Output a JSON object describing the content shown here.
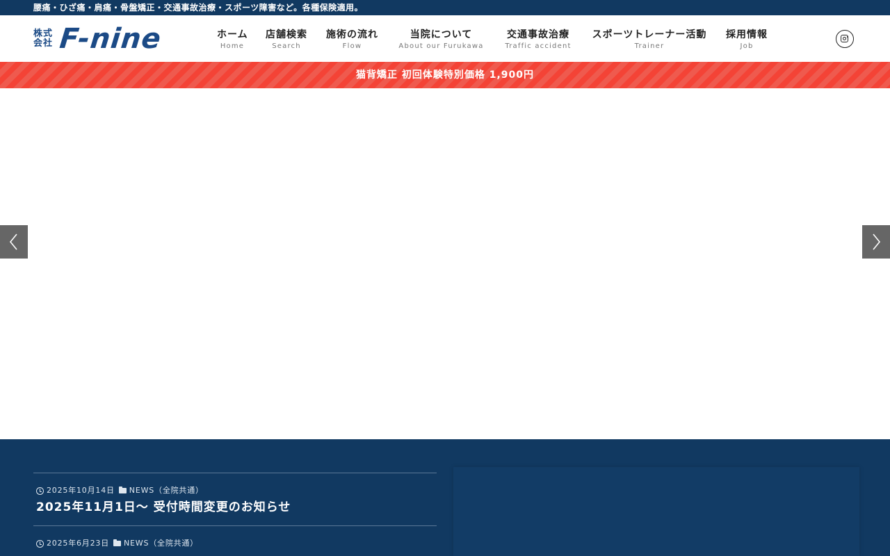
{
  "topbar": {
    "text": "腰痛・ひざ痛・肩痛・骨盤矯正・交通事故治療・スポーツ障害など。各種保険適用。"
  },
  "logo": {
    "kaisha_line1": "株式",
    "kaisha_line2": "会社",
    "brand": "F-nine"
  },
  "nav": {
    "items": [
      {
        "jp": "ホーム",
        "en": "Home"
      },
      {
        "jp": "店舗検索",
        "en": "Search"
      },
      {
        "jp": "施術の流れ",
        "en": "Flow"
      },
      {
        "jp": "当院について",
        "en": "About our Furukawa"
      },
      {
        "jp": "交通事故治療",
        "en": "Traffic accident"
      },
      {
        "jp": "スポーツトレーナー活動",
        "en": "Trainer"
      },
      {
        "jp": "採用情報",
        "en": "Job"
      }
    ]
  },
  "social": {
    "instagram_icon": "instagram-icon"
  },
  "promo": {
    "text": "猫背矯正 初回体験特別価格 1,900円"
  },
  "slider": {
    "prev_icon": "chevron-left-icon",
    "next_icon": "chevron-right-icon"
  },
  "news": {
    "items": [
      {
        "date": "2025年10月14日",
        "category": "NEWS（全院共通）",
        "title": "2025年11月1日〜 受付時間変更のお知らせ"
      },
      {
        "date": "2025年6月23日",
        "category": "NEWS（全院共通）",
        "title": ""
      }
    ]
  },
  "colors": {
    "navy": "#113961",
    "promo_red": "#f44336",
    "logo_blue": "#1b4a86"
  }
}
